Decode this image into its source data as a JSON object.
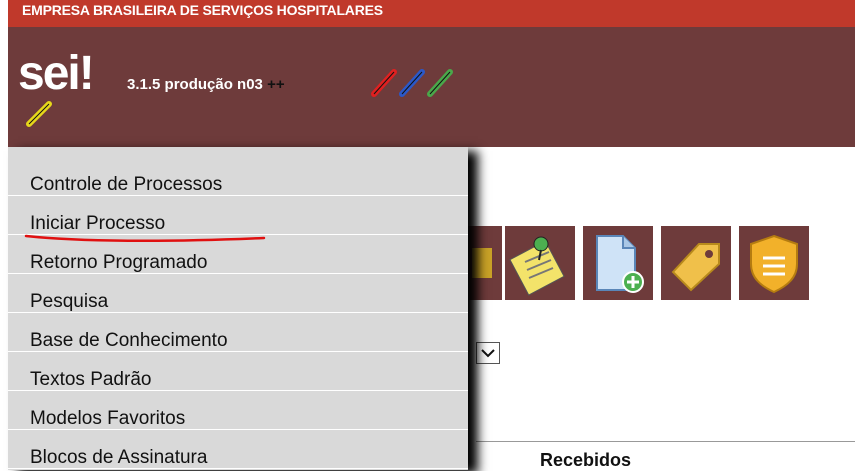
{
  "header": {
    "org": "EMPRESA BRASILEIRA DE SERVIÇOS HOSPITALARES",
    "logo": "sei!",
    "version": "3.1.5 produção n03",
    "version_suffix": "++"
  },
  "menu": {
    "items": [
      {
        "label": "Controle de Processos"
      },
      {
        "label": "Iniciar Processo"
      },
      {
        "label": "Retorno Programado"
      },
      {
        "label": "Pesquisa"
      },
      {
        "label": "Base de Conhecimento"
      },
      {
        "label": "Textos Padrão"
      },
      {
        "label": "Modelos Favoritos"
      },
      {
        "label": "Blocos de Assinatura"
      }
    ]
  },
  "toolbar": {
    "icons": [
      "note-pin-icon",
      "new-document-icon",
      "tag-icon",
      "shield-icon"
    ]
  },
  "table": {
    "recebidos_label": "Recebidos"
  },
  "colors": {
    "top_bar": "#c0392b",
    "header": "#6e3b3b",
    "menu_bg": "#d9d9d9",
    "annotation": "#e01010"
  }
}
